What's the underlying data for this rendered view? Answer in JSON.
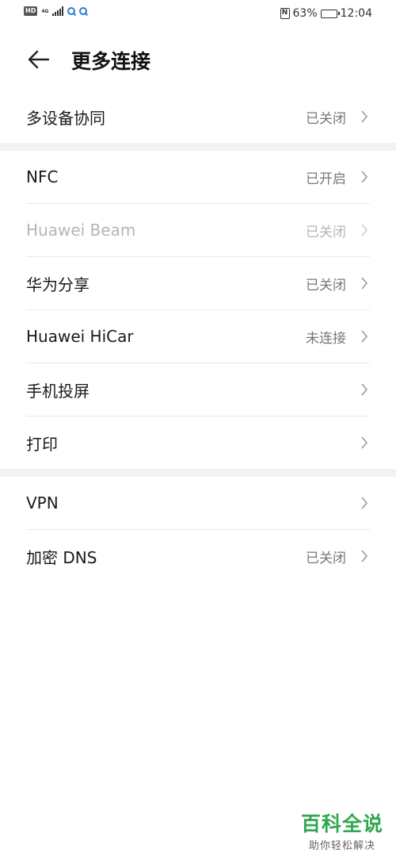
{
  "status_bar": {
    "left_badge": "HD",
    "network": "4G",
    "battery_percent": "63%",
    "battery_level": 0.63,
    "time": "12:04",
    "icons": [
      "hd-icon",
      "signal-icon",
      "app-notification-icon",
      "nfc-icon",
      "battery-icon"
    ]
  },
  "header": {
    "title": "更多连接"
  },
  "group1": {
    "items": [
      {
        "label": "多设备协同",
        "value": "已关闭"
      }
    ]
  },
  "group2": {
    "items": [
      {
        "label": "NFC",
        "value": "已开启"
      },
      {
        "label": "Huawei Beam",
        "value": "已关闭"
      },
      {
        "label": "华为分享",
        "value": "已关闭"
      },
      {
        "label": "Huawei HiCar",
        "value": "未连接"
      },
      {
        "label": "手机投屏",
        "value": ""
      },
      {
        "label": "打印",
        "value": ""
      }
    ]
  },
  "group3": {
    "items": [
      {
        "label": "VPN",
        "value": ""
      },
      {
        "label": "加密 DNS",
        "value": "已关闭"
      }
    ]
  },
  "watermark": {
    "title": "百科全说",
    "subtitle": "助你轻松解决"
  },
  "colors": {
    "accent_blue": "#2b7bd8",
    "disabled_text": "#b5b5b5",
    "watermark_green": "#2fa84f"
  }
}
